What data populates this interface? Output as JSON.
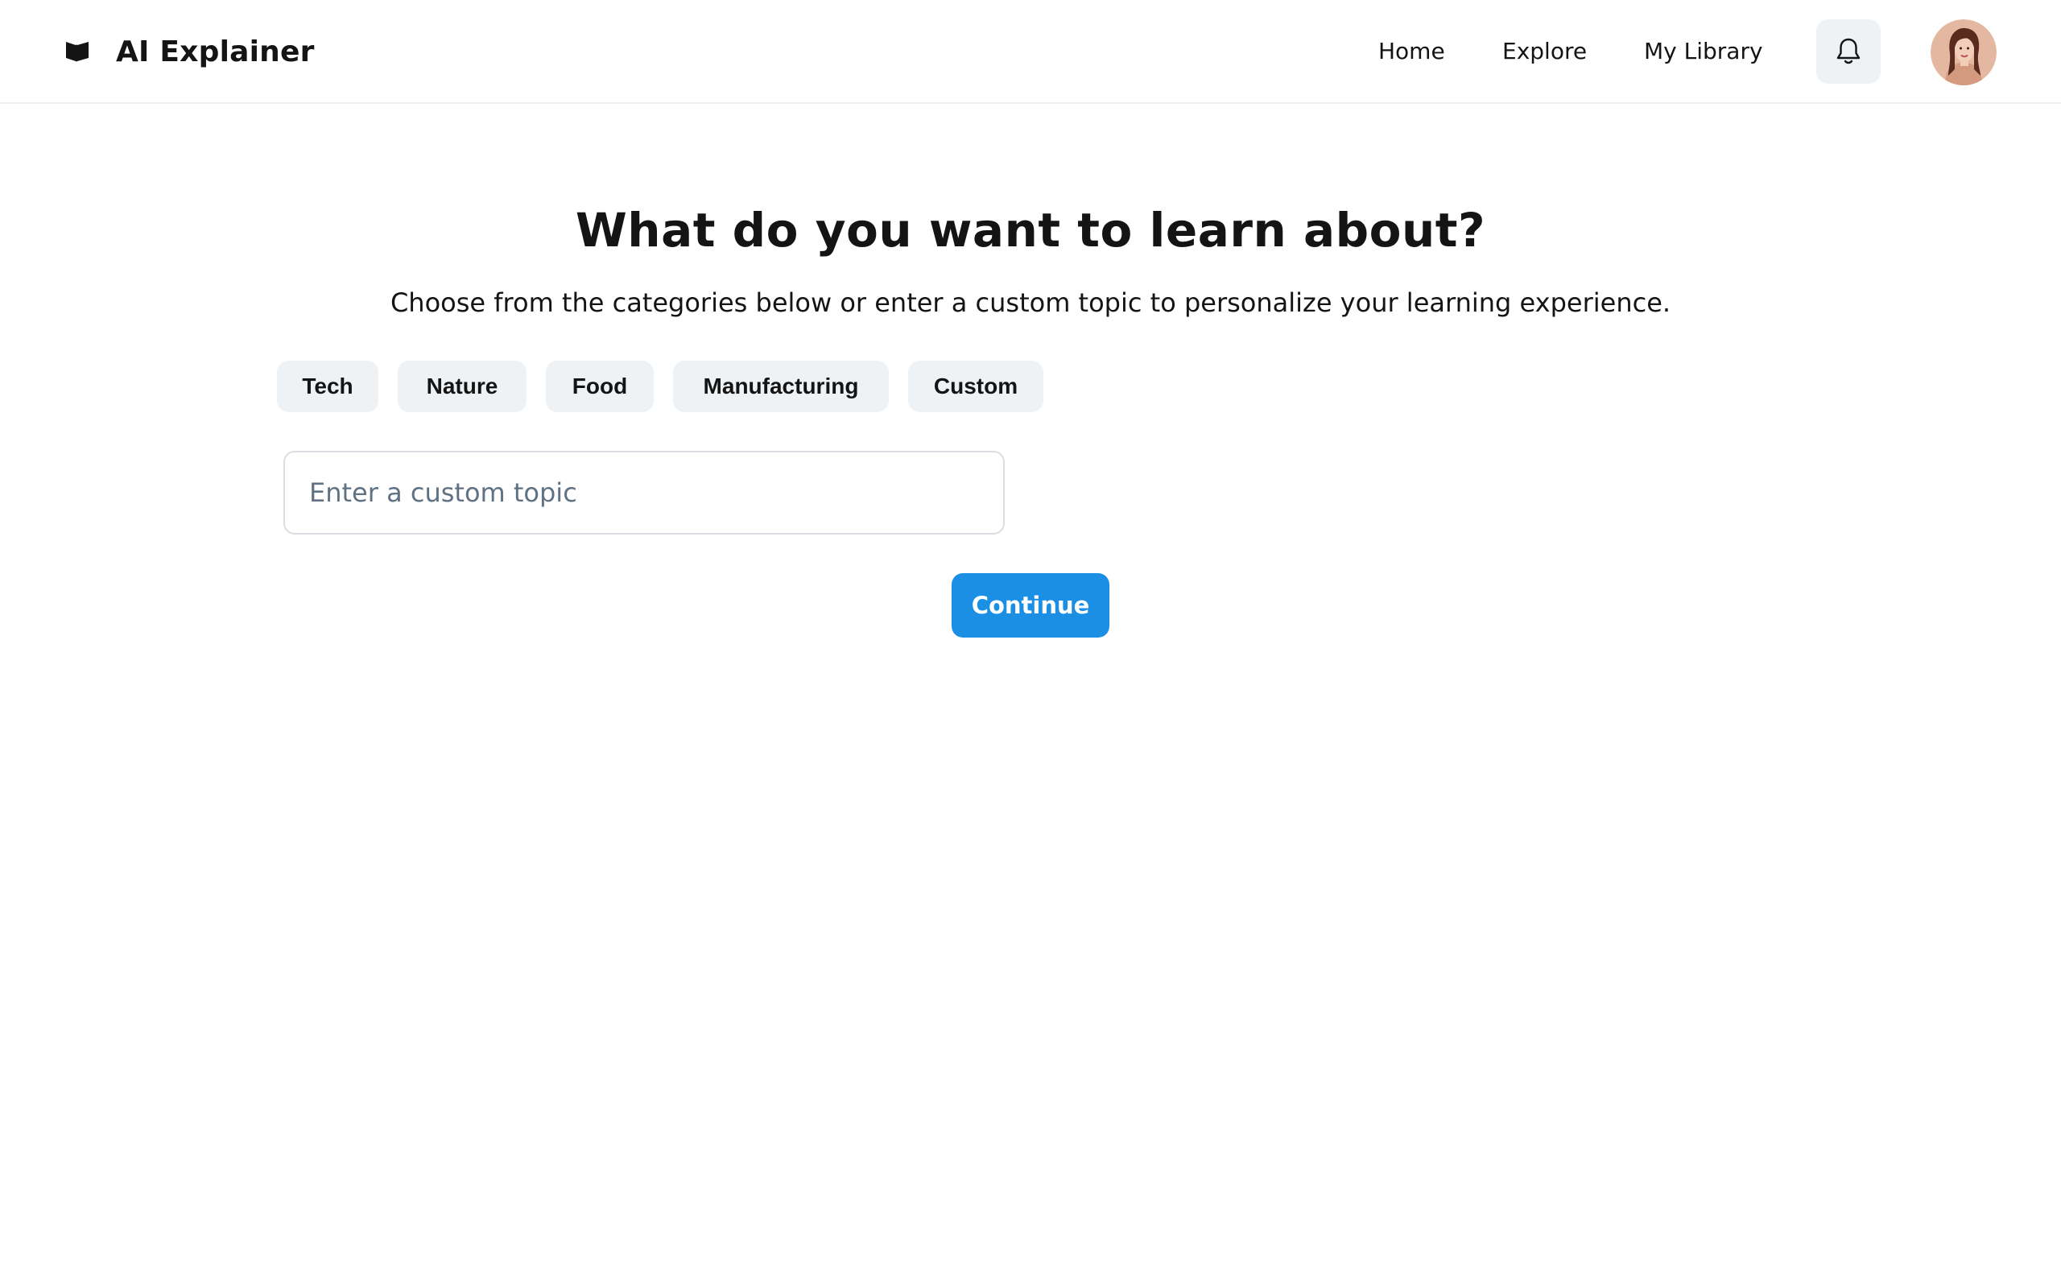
{
  "header": {
    "brand_title": "AI Explainer",
    "brand_icon": "book-icon",
    "nav": [
      {
        "label": "Home"
      },
      {
        "label": "Explore"
      },
      {
        "label": "My Library"
      }
    ],
    "notifications_icon": "bell-icon",
    "avatar": "user-avatar"
  },
  "main": {
    "title": "What do you want to learn about?",
    "subtitle": "Choose from the categories below or enter a custom topic to personalize your learning experience.",
    "categories": [
      {
        "label": "Tech"
      },
      {
        "label": "Nature"
      },
      {
        "label": "Food"
      },
      {
        "label": "Manufacturing"
      },
      {
        "label": "Custom"
      }
    ],
    "custom_topic": {
      "value": "",
      "placeholder": "Enter a custom topic"
    },
    "continue_label": "Continue"
  },
  "colors": {
    "accent": "#1a8fe3",
    "chip_background": "#eff2f4",
    "text": "#141414",
    "placeholder": "#5f7283"
  }
}
